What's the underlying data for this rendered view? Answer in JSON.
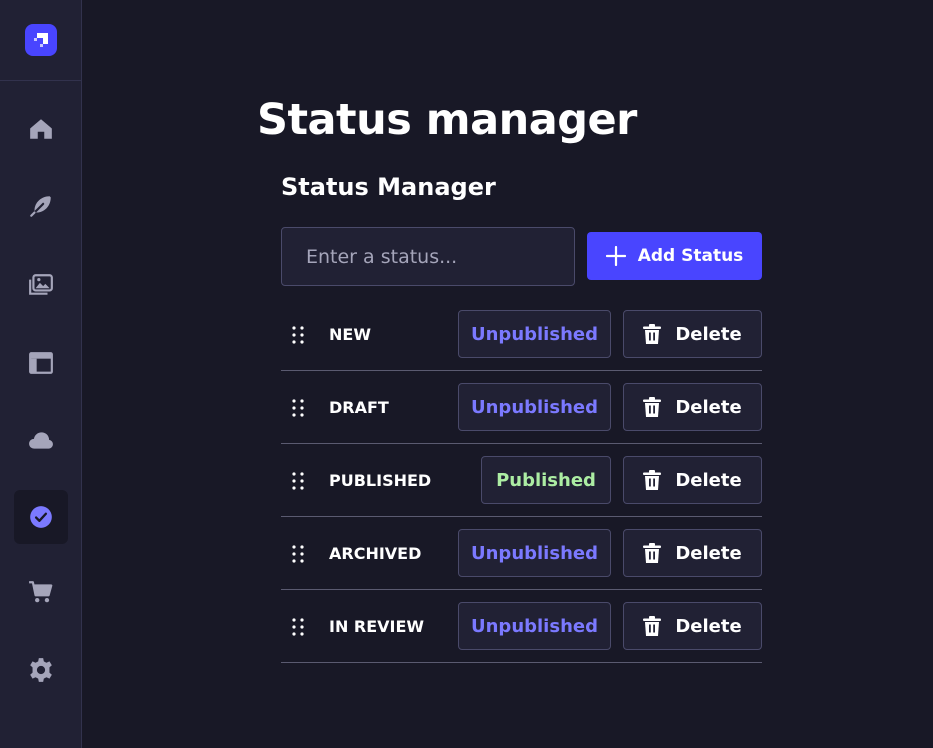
{
  "colors": {
    "background": "#181826",
    "sidebar": "#212134",
    "accent": "#4945ff",
    "unpublished": "#7b79ff",
    "published": "#aceda3"
  },
  "sidebar": {
    "logo": "strapi-logo-icon",
    "items": [
      {
        "icon": "home-icon",
        "active": false
      },
      {
        "icon": "feather-icon",
        "active": false
      },
      {
        "icon": "media-library-icon",
        "active": false
      },
      {
        "icon": "layout-icon",
        "active": false
      },
      {
        "icon": "cloud-icon",
        "active": false
      },
      {
        "icon": "check-circle-icon",
        "active": true
      },
      {
        "icon": "cart-icon",
        "active": false
      },
      {
        "icon": "gear-icon",
        "active": false
      }
    ]
  },
  "header": {
    "title": "Status manager"
  },
  "manager": {
    "title": "Status Manager",
    "input_placeholder": "Enter a status...",
    "input_value": "",
    "add_button_label": "Add Status",
    "delete_label": "Delete",
    "statuses": [
      {
        "name": "NEW",
        "state": "Unpublished"
      },
      {
        "name": "DRAFT",
        "state": "Unpublished"
      },
      {
        "name": "PUBLISHED",
        "state": "Published"
      },
      {
        "name": "ARCHIVED",
        "state": "Unpublished"
      },
      {
        "name": "IN REVIEW",
        "state": "Unpublished"
      }
    ]
  }
}
